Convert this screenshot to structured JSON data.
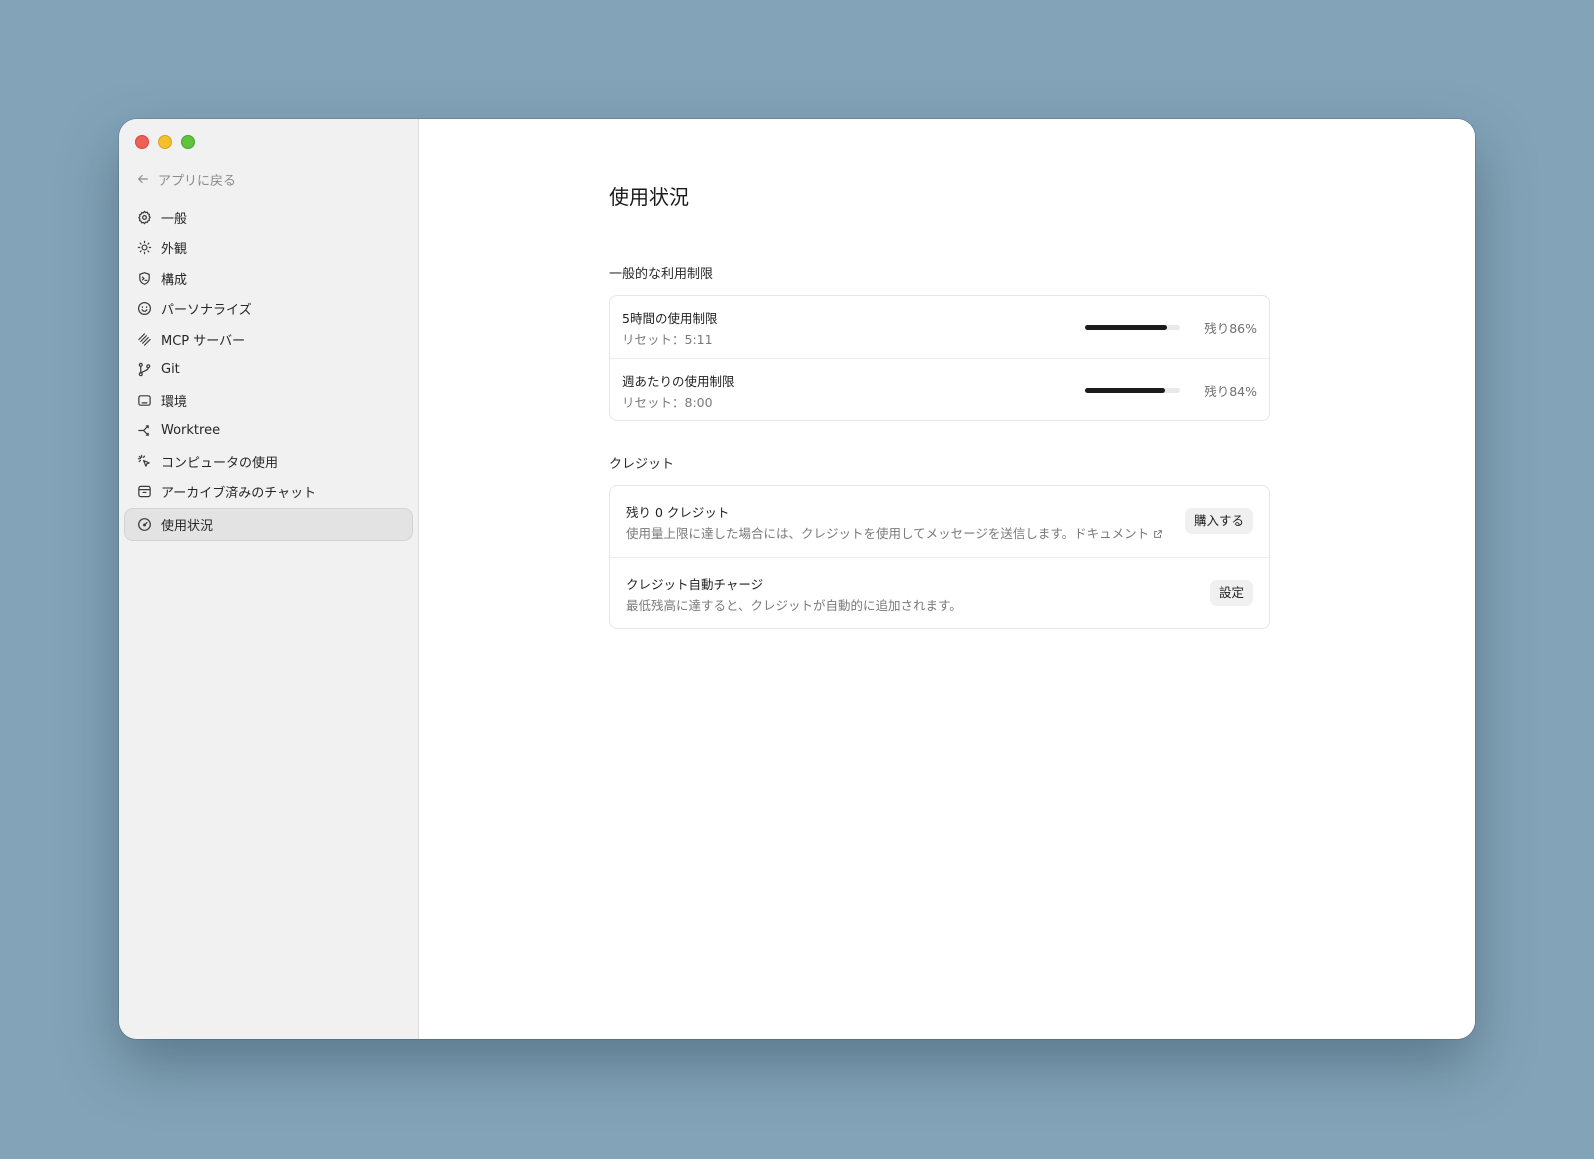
{
  "window": {
    "traffic_lights": [
      "close",
      "minimize",
      "zoom"
    ]
  },
  "sidebar": {
    "back_label": "アプリに戻る",
    "items": [
      {
        "label": "一般",
        "icon": "gear-icon"
      },
      {
        "label": "外観",
        "icon": "sun-icon"
      },
      {
        "label": "構成",
        "icon": "shield-terminal-icon"
      },
      {
        "label": "パーソナライズ",
        "icon": "smile-icon"
      },
      {
        "label": "MCP サーバー",
        "icon": "mcp-icon"
      },
      {
        "label": "Git",
        "icon": "git-branch-icon"
      },
      {
        "label": "環境",
        "icon": "monitor-icon"
      },
      {
        "label": "Worktree",
        "icon": "worktree-icon"
      },
      {
        "label": "コンピュータの使用",
        "icon": "cursor-click-icon"
      },
      {
        "label": "アーカイブ済みのチャット",
        "icon": "archive-icon"
      },
      {
        "label": "使用状況",
        "icon": "gauge-icon",
        "active": true
      }
    ]
  },
  "main": {
    "title": "使用状況",
    "limits": {
      "heading": "一般的な利用制限",
      "rows": [
        {
          "name": "5時間の使用制限",
          "reset": "リセット：5:11",
          "remaining_fraction": 0.86,
          "remaining_label": "残り86%"
        },
        {
          "name": "週あたりの使用制限",
          "reset": "リセット：8:00",
          "remaining_fraction": 0.84,
          "remaining_label": "残り84%"
        }
      ]
    },
    "credits": {
      "heading": "クレジット",
      "balance": {
        "title": "残り 0 クレジット",
        "description": "使用量上限に達した場合には、クレジットを使用してメッセージを送信します。ドキュメント",
        "button": "購入する"
      },
      "auto_charge": {
        "title": "クレジット自動チャージ",
        "description": "最低残高に達すると、クレジットが自動的に追加されます。",
        "button": "設定"
      }
    }
  }
}
